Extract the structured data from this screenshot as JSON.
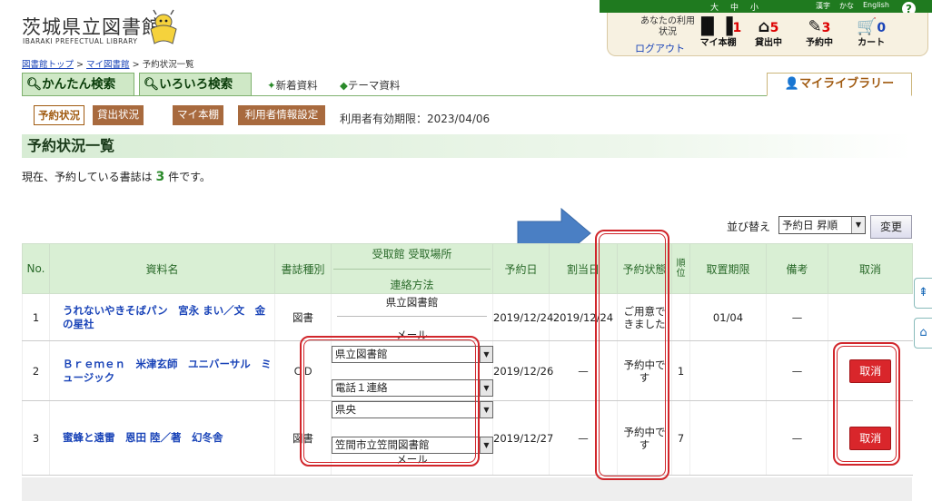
{
  "top_bar": {
    "size_options": [
      "大",
      "中",
      "小"
    ],
    "lang_options": [
      "漢字",
      "かな",
      "English"
    ],
    "help": "?"
  },
  "header": {
    "title": "茨城県立図書館",
    "subtitle": "IBARAKI PREFECTUAL LIBRARY"
  },
  "user_status": {
    "label": "あなたの利用状況",
    "logout": "ログアウト",
    "stats": [
      {
        "label": "マイ本棚",
        "count": "1",
        "icon": "bookshelf-icon"
      },
      {
        "label": "貸出中",
        "count": "5",
        "icon": "house-icon"
      },
      {
        "label": "予約中",
        "count": "3",
        "icon": "reserve-icon"
      },
      {
        "label": "カート",
        "count": "0",
        "icon": "cart-icon"
      }
    ]
  },
  "breadcrumb": {
    "items": [
      "図書館トップ",
      "マイ図書館",
      "予約状況一覧"
    ],
    "sep": ">"
  },
  "search_tabs": {
    "simple": "かんたん検索",
    "advanced": "いろいろ検索",
    "new_items": "新着資料",
    "theme": "テーマ資料",
    "mylibrary": "マイライブラリー"
  },
  "subnav": {
    "items": [
      "予約状況",
      "貸出状況",
      "マイ本棚",
      "利用者情報設定"
    ],
    "valid_date": "利用者有効期限：2023/04/06"
  },
  "page": {
    "heading": "予約状況一覧",
    "count_prefix": "現在、予約している書誌は",
    "count": "3",
    "count_suffix": "件です。"
  },
  "sort": {
    "label": "並び替え",
    "selected": "予約日 昇順",
    "button": "変更"
  },
  "table": {
    "headers": {
      "no": "No.",
      "title": "資料名",
      "type": "書誌種別",
      "pickup_place": "受取館 受取場所",
      "contact": "連絡方法",
      "reserve_date": "予約日",
      "assign_date": "割当日",
      "status": "予約状態",
      "rank": "順位",
      "hold_limit": "取置期限",
      "note": "備考",
      "cancel": "取消"
    },
    "rows": [
      {
        "no": "1",
        "title": "うれないやきそばパン　宮永 まい／文　金の星社",
        "type": "図書",
        "pickup": "県立図書館",
        "contact": "メール",
        "reserve_date": "2019/12/24",
        "assign_date": "2019/12/24",
        "status": "ご用意できました",
        "rank": "",
        "limit": "01/04",
        "note": "—",
        "cancel": ""
      },
      {
        "no": "2",
        "title": "Ｂｒｅｍｅｎ　米津玄師　ユニバーサル　ミュージック",
        "type": "ＣＤ",
        "pickup": "県立図書館",
        "contact": "電話１連絡",
        "reserve_date": "2019/12/26",
        "assign_date": "—",
        "status": "予約中です",
        "rank": "1",
        "limit": "",
        "note": "—",
        "cancel": "取消"
      },
      {
        "no": "3",
        "title": "蜜蜂と遠雷　恩田 陸／著　幻冬舎",
        "type": "図書",
        "pickup": "県央",
        "contact": "笠間市立笠間図書館",
        "contact_under": "メール",
        "reserve_date": "2019/12/27",
        "assign_date": "—",
        "status": "予約中です",
        "rank": "7",
        "limit": "",
        "note": "—",
        "cancel": "取消"
      }
    ]
  },
  "colors": {
    "brand_green": "#1f7a1f",
    "header_bg": "#d9efd4",
    "cancel_red": "#d9262b",
    "annotation_red": "#d1262b",
    "arrow_blue": "#4a7fc4"
  }
}
